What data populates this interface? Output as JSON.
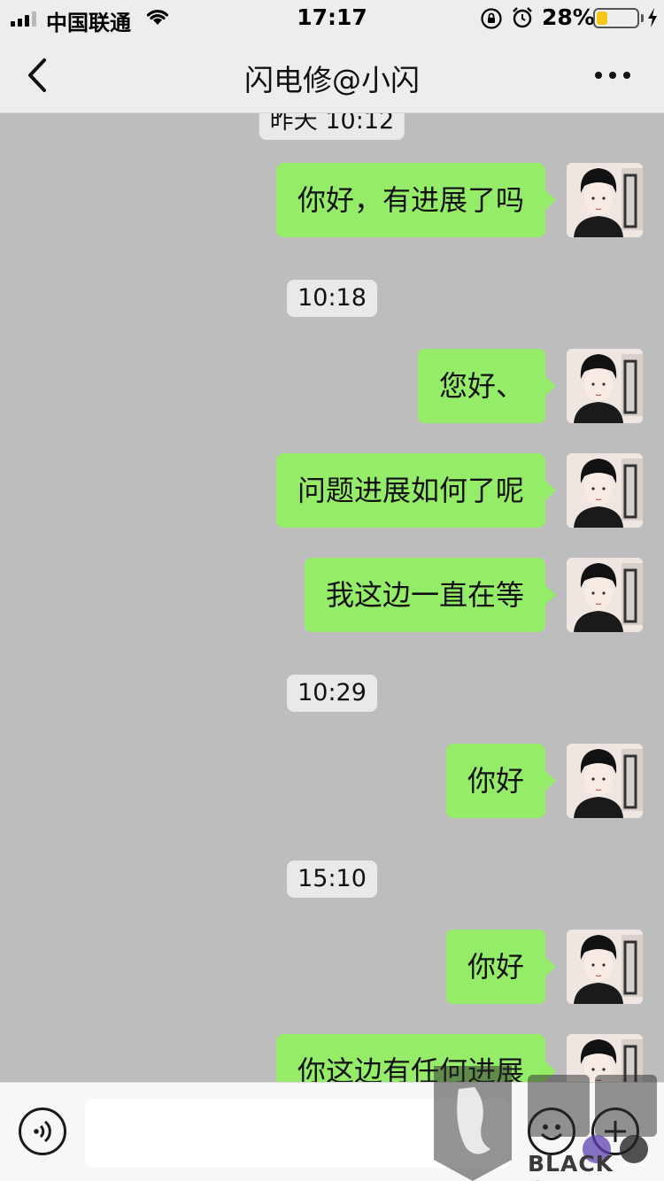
{
  "status_bar": {
    "carrier": "中国联通",
    "time": "17:17",
    "battery_percent": "28%",
    "battery_level": 0.28,
    "battery_color": "#f5c518",
    "icons": [
      "signal-icon",
      "wifi-icon",
      "orientation-lock-icon",
      "alarm-icon",
      "battery-icon",
      "charging-bolt-icon"
    ]
  },
  "nav": {
    "title": "闪电修@小闪",
    "back_icon": "chevron-left-icon",
    "more_icon": "more-dots-icon"
  },
  "chat": {
    "partial_timestamp": "昨天 10:12",
    "timestamps": [
      "10:18",
      "10:29",
      "15:10"
    ],
    "messages": [
      "你好，有进展了吗",
      "您好、",
      "问题进展如何了呢",
      "我这边一直在等",
      "你好",
      "你好",
      "你这边有任何进展"
    ],
    "bubble_color": "#95ec69"
  },
  "input_bar": {
    "voice_icon": "voice-input-icon",
    "emoji_icon": "emoji-icon",
    "plus_icon": "plus-icon",
    "input_value": ""
  },
  "watermark": {
    "text": "BLACK CAT"
  }
}
